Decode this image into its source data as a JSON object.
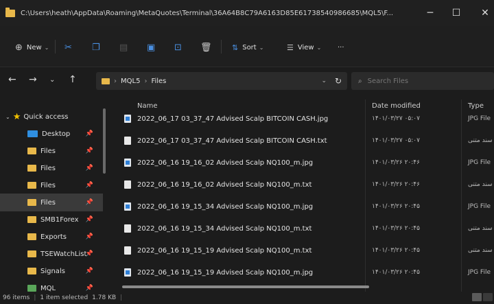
{
  "window": {
    "title": "C:\\Users\\heath\\AppData\\Roaming\\MetaQuotes\\Terminal\\36A64B8C79A6163D85E61738540986685\\MQL5\\F...",
    "minimize": "─",
    "maximize": "☐",
    "close": "✕"
  },
  "toolbar": {
    "new_label": "New",
    "sort_label": "Sort",
    "view_label": "View",
    "more_label": "···"
  },
  "address": {
    "path": [
      "MQL5",
      "Files"
    ],
    "search_placeholder": "Search Files"
  },
  "sidebar": {
    "quick_access_label": "Quick access",
    "items": [
      {
        "label": "Desktop",
        "icon": "desktop-icon"
      },
      {
        "label": "Files",
        "icon": "folder-icon"
      },
      {
        "label": "Files",
        "icon": "folder-icon"
      },
      {
        "label": "Files",
        "icon": "folder-icon"
      },
      {
        "label": "Files",
        "icon": "folder-icon",
        "selected": true
      },
      {
        "label": "SMB1Forex",
        "icon": "folder-icon"
      },
      {
        "label": "Exports",
        "icon": "folder-icon"
      },
      {
        "label": "TSEWatchList",
        "icon": "folder-icon"
      },
      {
        "label": "Signals",
        "icon": "folder-icon"
      },
      {
        "label": "MQL",
        "icon": "green-folder-icon"
      }
    ]
  },
  "columns": {
    "name": "Name",
    "date": "Date modified",
    "type": "Type"
  },
  "files": [
    {
      "name": "2022_06_17 03_37_47 Advised Scalp BITCOIN CASH.jpg",
      "date": "۱۴۰۱/۰۳/۲۷ ۰۵:۰۷",
      "type": "JPG File",
      "kind": "jpg"
    },
    {
      "name": "2022_06_17 03_37_47 Advised Scalp BITCOIN CASH.txt",
      "date": "۱۴۰۱/۰۳/۲۷ ۰۵:۰۷",
      "type": "سند متنی",
      "kind": "txt"
    },
    {
      "name": "2022_06_16 19_16_02 Advised Scalp NQ100_m.jpg",
      "date": "۱۴۰۱/۰۳/۲۶ ۲۰:۴۶",
      "type": "JPG File",
      "kind": "jpg"
    },
    {
      "name": "2022_06_16 19_16_02 Advised Scalp NQ100_m.txt",
      "date": "۱۴۰۱/۰۳/۲۶ ۲۰:۴۶",
      "type": "سند متنی",
      "kind": "txt"
    },
    {
      "name": "2022_06_16 19_15_34 Advised Scalp NQ100_m.jpg",
      "date": "۱۴۰۱/۰۳/۲۶ ۲۰:۴۵",
      "type": "JPG File",
      "kind": "jpg"
    },
    {
      "name": "2022_06_16 19_15_34 Advised Scalp NQ100_m.txt",
      "date": "۱۴۰۱/۰۳/۲۶ ۲۰:۴۵",
      "type": "سند متنی",
      "kind": "txt"
    },
    {
      "name": "2022_06_16 19_15_19 Advised Scalp NQ100_m.txt",
      "date": "۱۴۰۱/۰۳/۲۶ ۲۰:۴۵",
      "type": "سند متنی",
      "kind": "txt"
    },
    {
      "name": "2022_06_16 19_15_19 Advised Scalp NQ100_m.jpg",
      "date": "۱۴۰۱/۰۳/۲۶ ۲۰:۴۵",
      "type": "JPG File",
      "kind": "jpg"
    }
  ],
  "status": {
    "items": "96 items",
    "selected": "1 item selected",
    "size": "1.78 KB"
  },
  "colors": {
    "folder": "#e8b84a",
    "accent": "#2f8fe0",
    "star": "#f2c200"
  }
}
